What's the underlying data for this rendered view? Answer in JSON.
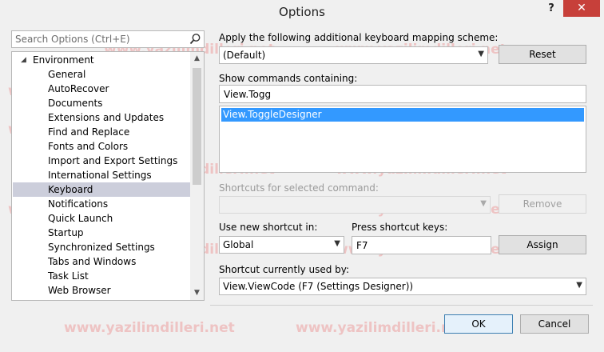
{
  "window": {
    "title": "Options",
    "help_label": "?",
    "close_label": "✕"
  },
  "search": {
    "placeholder": "Search Options (Ctrl+E)"
  },
  "tree": {
    "root_label": "Environment",
    "items": [
      "General",
      "AutoRecover",
      "Documents",
      "Extensions and Updates",
      "Find and Replace",
      "Fonts and Colors",
      "Import and Export Settings",
      "International Settings",
      "Keyboard",
      "Notifications",
      "Quick Launch",
      "Startup",
      "Synchronized Settings",
      "Tabs and Windows",
      "Task List",
      "Web Browser"
    ],
    "selected": "Keyboard"
  },
  "mapping": {
    "label": "Apply the following additional keyboard mapping scheme:",
    "value": "(Default)",
    "reset_label": "Reset"
  },
  "commands": {
    "label": "Show commands containing:",
    "filter_value": "View.Togg",
    "results": [
      "View.ToggleDesigner"
    ]
  },
  "shortcuts": {
    "label": "Shortcuts for selected command:",
    "value": "",
    "remove_label": "Remove"
  },
  "new_shortcut": {
    "scope_label": "Use new shortcut in:",
    "scope_value": "Global",
    "keys_label": "Press shortcut keys:",
    "keys_value": "F7",
    "assign_label": "Assign"
  },
  "current_usage": {
    "label": "Shortcut currently used by:",
    "value": "View.ViewCode (F7 (Settings Designer))"
  },
  "footer": {
    "ok_label": "OK",
    "cancel_label": "Cancel"
  },
  "watermark": "www.yazilimdilleri.net",
  "colors": {
    "selection": "#3399ff",
    "tree_selection": "#cccedb",
    "close_button": "#c7403a",
    "watermark": "#eb8c8c"
  }
}
